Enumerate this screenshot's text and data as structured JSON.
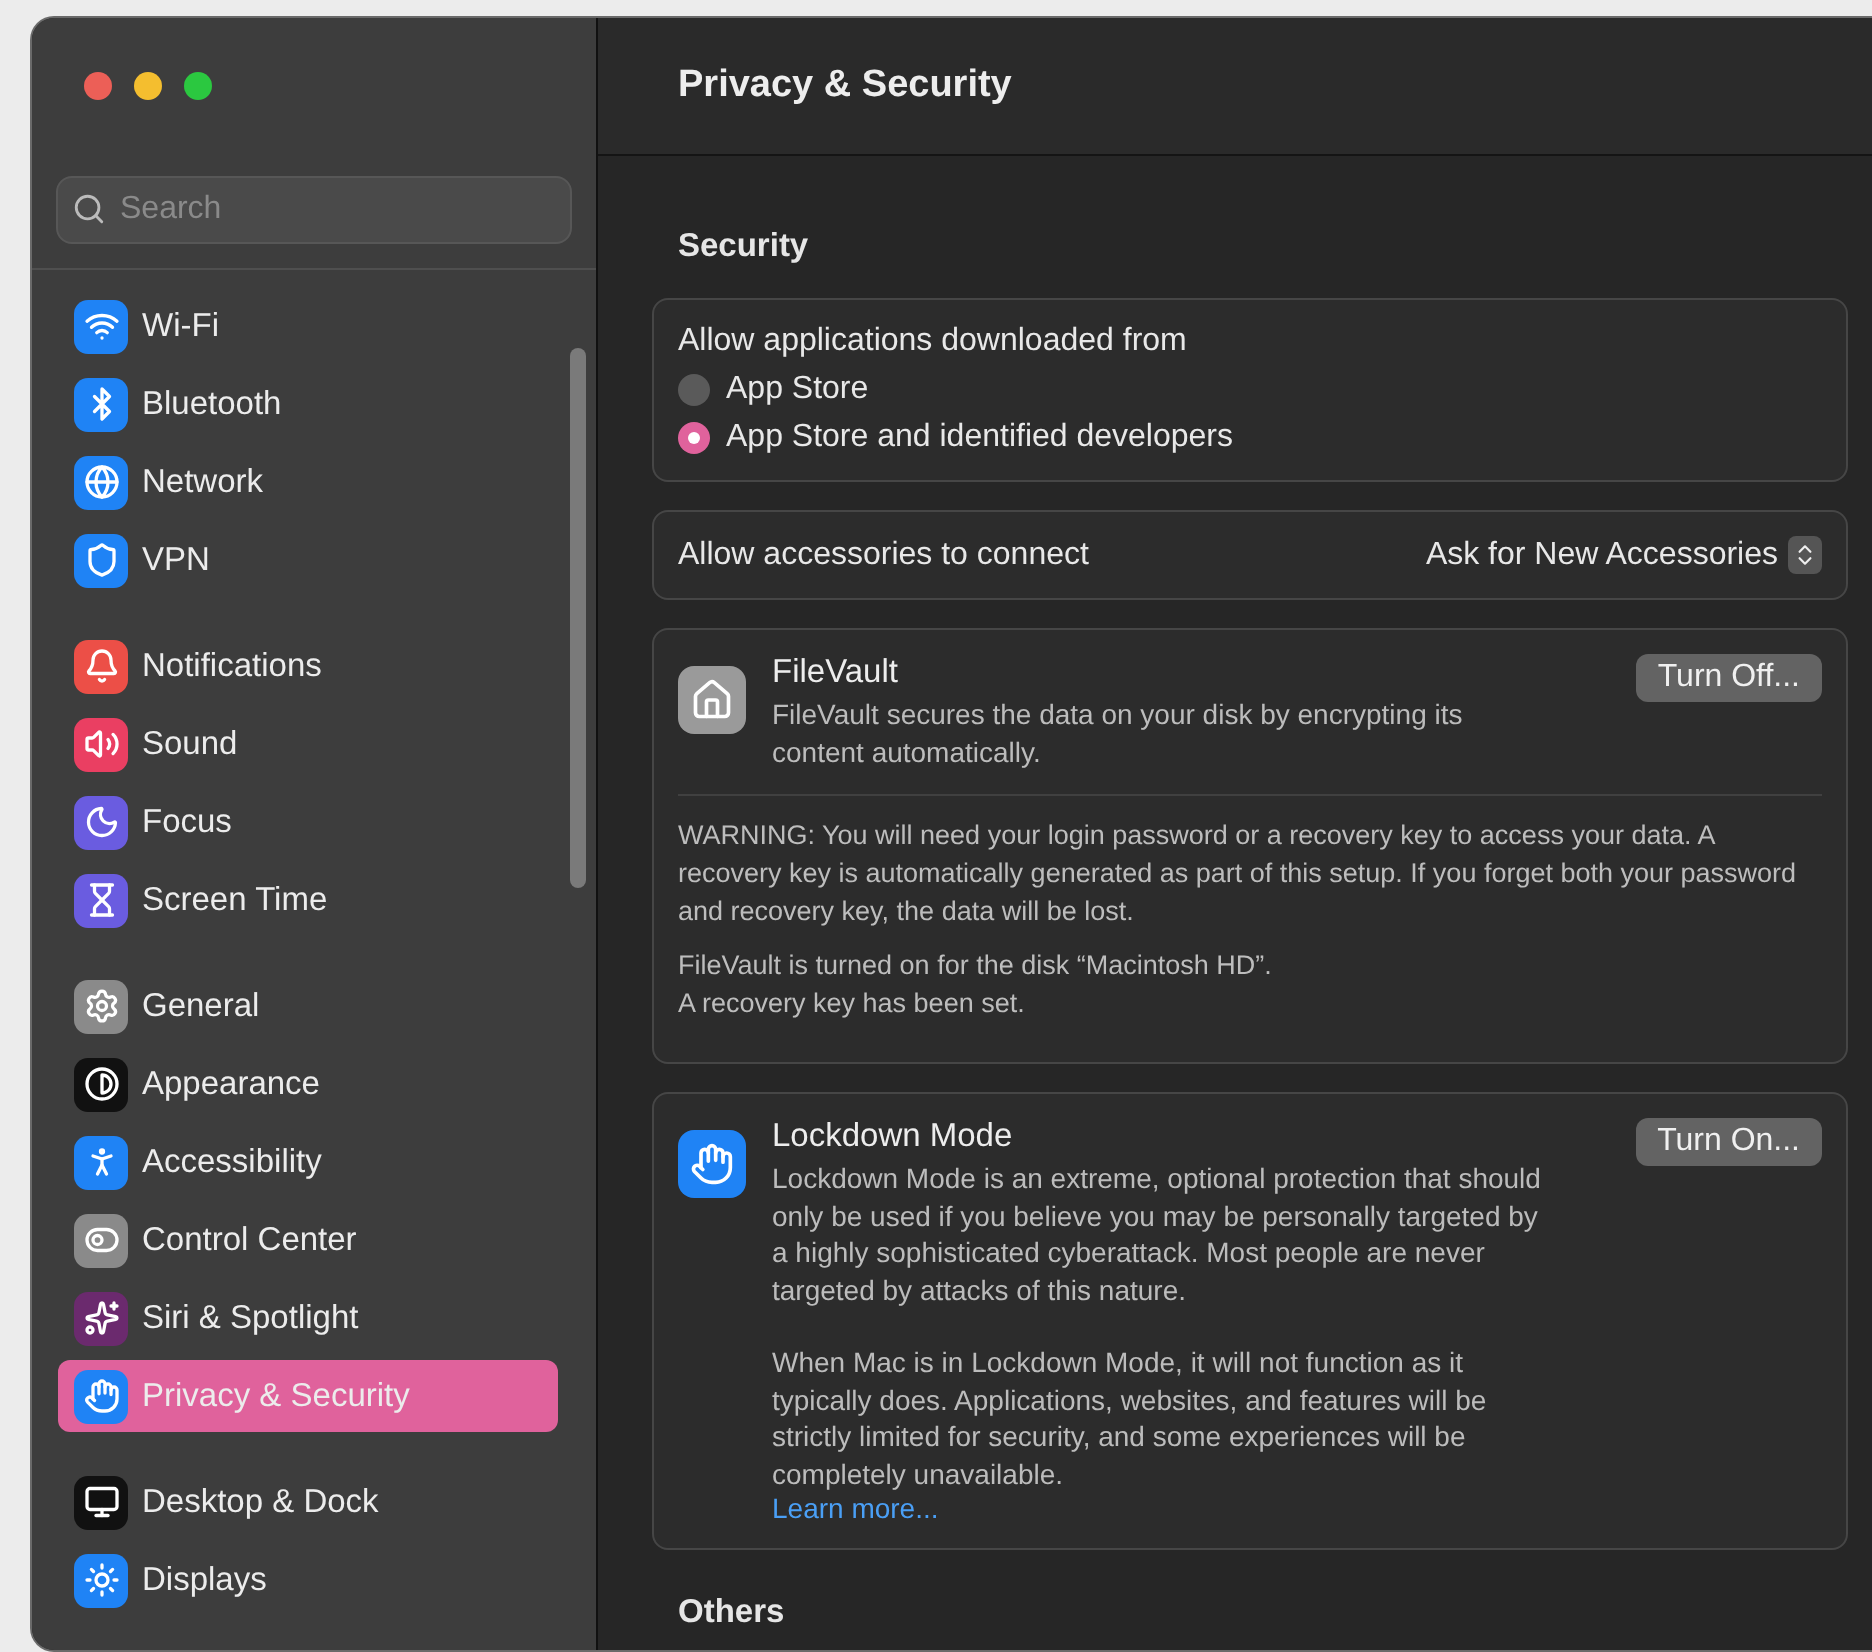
{
  "window": {
    "title": "Privacy & Security"
  },
  "search": {
    "placeholder": "Search"
  },
  "sidebar": {
    "groups": [
      [
        {
          "label": "Wi-Fi",
          "selected": false
        },
        {
          "label": "Bluetooth",
          "selected": false
        },
        {
          "label": "Network",
          "selected": false
        },
        {
          "label": "VPN",
          "selected": false
        }
      ],
      [
        {
          "label": "Notifications",
          "selected": false
        },
        {
          "label": "Sound",
          "selected": false
        },
        {
          "label": "Focus",
          "selected": false
        },
        {
          "label": "Screen Time",
          "selected": false
        }
      ],
      [
        {
          "label": "General",
          "selected": false
        },
        {
          "label": "Appearance",
          "selected": false
        },
        {
          "label": "Accessibility",
          "selected": false
        },
        {
          "label": "Control Center",
          "selected": false
        },
        {
          "label": "Siri & Spotlight",
          "selected": false
        },
        {
          "label": "Privacy & Security",
          "selected": true
        }
      ],
      [
        {
          "label": "Desktop & Dock",
          "selected": false
        },
        {
          "label": "Displays",
          "selected": false
        }
      ]
    ]
  },
  "security": {
    "heading": "Security",
    "downloads": {
      "label": "Allow applications downloaded from",
      "options": [
        {
          "label": "App Store",
          "selected": false
        },
        {
          "label": "App Store and identified developers",
          "selected": true
        }
      ]
    },
    "accessories": {
      "label": "Allow accessories to connect",
      "value": "Ask for New Accessories"
    },
    "filevault": {
      "title": "FileVault",
      "description": "FileVault secures the data on your disk by encrypting its content automatically.",
      "button": "Turn Off...",
      "warning": "WARNING: You will need your login password or a recovery key to access your data. A recovery key is automatically generated as part of this setup. If you forget both your password and recovery key, the data will be lost.",
      "status": [
        "FileVault is turned on for the disk “Macintosh HD”.",
        "A recovery key has been set."
      ]
    },
    "lockdown": {
      "title": "Lockdown Mode",
      "button": "Turn On...",
      "paragraphs": [
        "Lockdown Mode is an extreme, optional protection that should only be used if you believe you may be personally targeted by a highly sophisticated cyberattack. Most people are never targeted by attacks of this nature.",
        "When Mac is in Lockdown Mode, it will not function as it typically does. Applications, websites, and features will be strictly limited for security, and some experiences will be completely unavailable."
      ],
      "link": "Learn more..."
    }
  },
  "others": {
    "heading": "Others"
  }
}
